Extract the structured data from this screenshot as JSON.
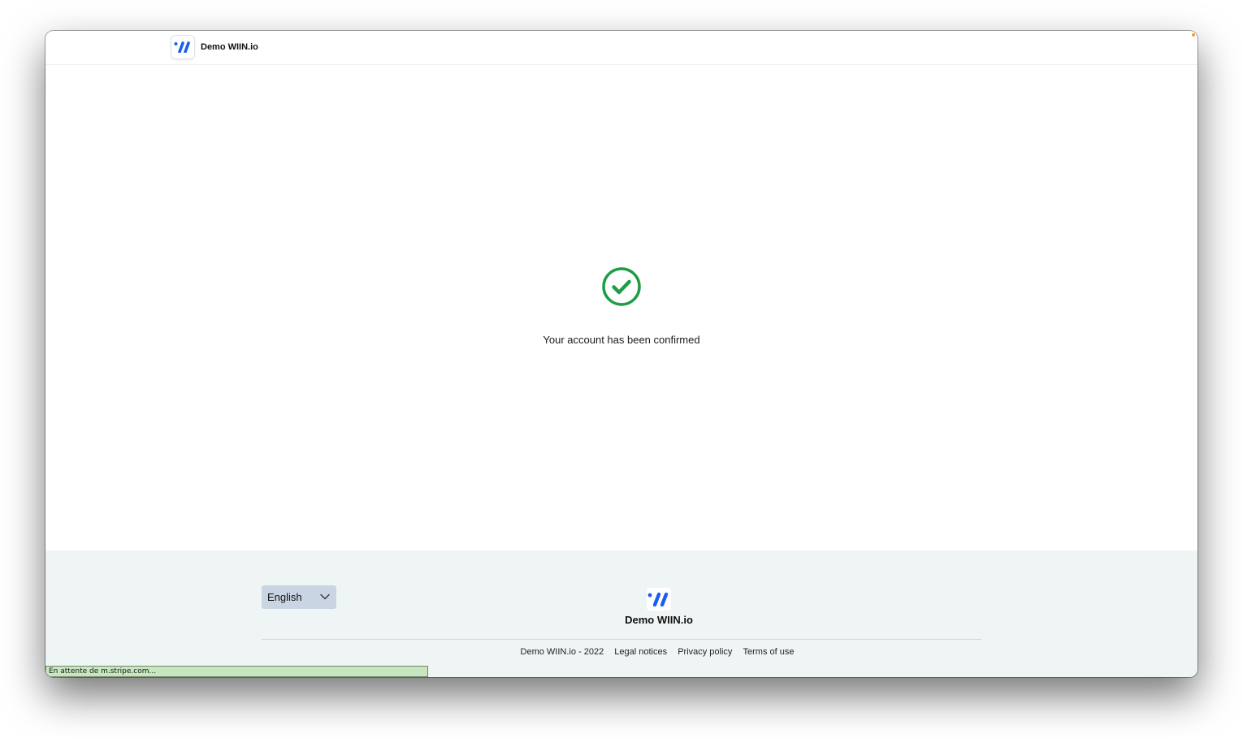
{
  "header": {
    "brand_name": "Demo WIIN.io",
    "logo_icon": "wiin-logo-icon"
  },
  "main": {
    "status_icon": "check-circle-icon",
    "confirmation_message": "Your account has been confirmed"
  },
  "footer": {
    "language_selected": "English",
    "brand_name": "Demo WIIN.io",
    "copyright": "Demo WIIN.io - 2022",
    "links": [
      "Legal notices",
      "Privacy policy",
      "Terms of use"
    ]
  },
  "browser_status": "En attente de m.stripe.com...",
  "colors": {
    "brand_blue": "#1a5ff0",
    "success_green": "#1f9d44",
    "footer_bg": "#eff4f5",
    "select_bg": "#c9d5e3",
    "status_bar_bg": "#c8e6c0"
  }
}
